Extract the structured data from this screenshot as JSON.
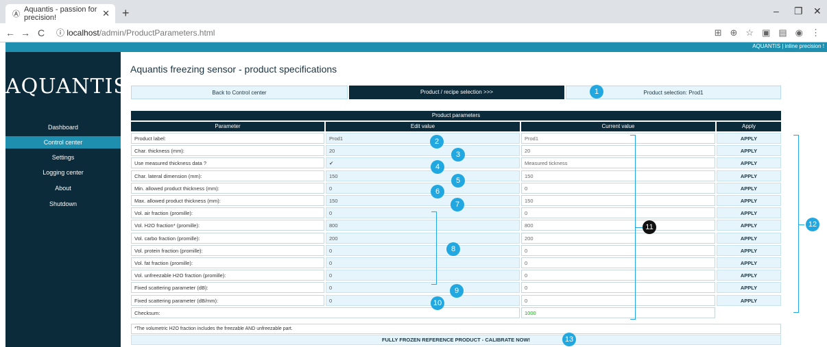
{
  "browser": {
    "tab_title": "Aquantis - passion for precision!",
    "tab_close": "✕",
    "new_tab": "+",
    "url_host": "localhost",
    "url_path": "/admin/ProductParameters.html",
    "minimize": "–",
    "restore": "❐",
    "close": "✕"
  },
  "app": {
    "brand_line": "AQUANTIS | inline precision !",
    "logo": "AQUANTIS",
    "page_title": "Aquantis freezing sensor - product specifications"
  },
  "sidebar": {
    "items": [
      {
        "label": "Dashboard"
      },
      {
        "label": "Control center"
      },
      {
        "label": "Settings"
      },
      {
        "label": "Logging center"
      },
      {
        "label": "About"
      },
      {
        "label": "Shutdown"
      }
    ]
  },
  "buttons": {
    "back": "Back to Control center",
    "recipe": "Product / recipe selection >>>",
    "selection": "Product selection: Prod1"
  },
  "table": {
    "title": "Product parameters",
    "headers": [
      "Parameter",
      "Edit value",
      "Current value",
      "Apply"
    ],
    "apply_label": "APPLY",
    "rows": [
      {
        "param": "Product label:",
        "edit": "Prod1",
        "current": "Prod1"
      },
      {
        "param": "Char. thickness (mm):",
        "edit": "20",
        "current": "20"
      },
      {
        "param": "Use measured thickness data ?",
        "edit": "✔",
        "current": "Measured tickness"
      },
      {
        "param": "Char. lateral dimension (mm):",
        "edit": "150",
        "current": "150"
      },
      {
        "param": "Min. allowed product thickness (mm):",
        "edit": "0",
        "current": "0"
      },
      {
        "param": "Max. allowed product thickness (mm):",
        "edit": "150",
        "current": "150"
      },
      {
        "param": "Vol. air fraction (promille):",
        "edit": "0",
        "current": "0"
      },
      {
        "param": "Vol. H2O fraction* (promille):",
        "edit": "800",
        "current": "800"
      },
      {
        "param": "Vol. carbo fraction (promille):",
        "edit": "200",
        "current": "200"
      },
      {
        "param": "Vol. protein fraction (promille):",
        "edit": "0",
        "current": "0"
      },
      {
        "param": "Vol. fat fraction (promille):",
        "edit": "0",
        "current": "0"
      },
      {
        "param": "Vol. unfreezable H2O fraction (promille):",
        "edit": "0",
        "current": "0"
      },
      {
        "param": "Fixed scattering parameter (dB):",
        "edit": "0",
        "current": "0"
      },
      {
        "param": "Fixed scattering parameter (dB/mm):",
        "edit": "0",
        "current": "0"
      }
    ],
    "checksum_label": "Checksum:",
    "checksum_value": "1000"
  },
  "footnote": "*The volumetric H2O fraction includes the freezable AND unfreezable part.",
  "calibrate_label": "FULLY FROZEN REFERENCE PRODUCT - CALIBRATE NOW!",
  "annotations": [
    "1",
    "2",
    "3",
    "4",
    "5",
    "6",
    "7",
    "8",
    "9",
    "10",
    "11",
    "12",
    "13"
  ],
  "colors": {
    "dark": "#0b2a3a",
    "accent": "#1f8fb0",
    "badge": "#22a8e0",
    "checksum": "#1aa01a"
  }
}
